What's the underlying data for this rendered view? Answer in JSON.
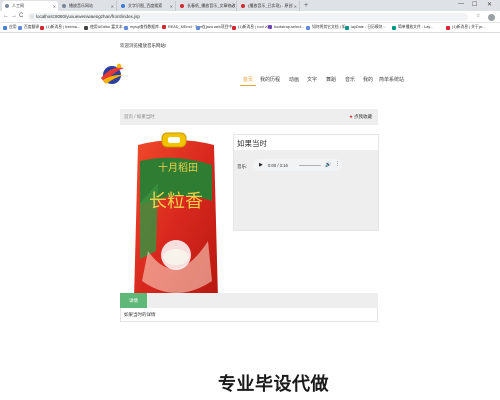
{
  "browser": {
    "tabs": [
      {
        "title": "人工网"
      },
      {
        "title": "播放音乐网站"
      },
      {
        "title": "文字识图_百度搜索"
      },
      {
        "title": "长春纸_播放音乐_文章修改"
      },
      {
        "title": "(播放音乐_已实现) - 原创"
      }
    ],
    "new_tab": "+",
    "window_controls": {
      "minimize": "—",
      "maximize": "☐",
      "close": "✕"
    },
    "nav": {
      "back": "←",
      "forward": "→",
      "reload": "C"
    },
    "url": "localhost:8080/yuxueweniwaengzhan/front/index.jsp",
    "bookmarks": [
      {
        "label": "应用"
      },
      {
        "label": "百度翻译"
      },
      {
        "label": "(1)新消息 | freema..."
      },
      {
        "label": "使用UEditor 富文本..."
      },
      {
        "label": "mysql查找数据库..."
      },
      {
        "label": "READ_MEmd · Tem..."
      },
      {
        "label": "在java web项目中..."
      },
      {
        "label": "(1)新消息 | root v0..."
      },
      {
        "label": "bootstrap-select..."
      },
      {
        "label": "如何将其它文档 | 如..."
      },
      {
        "label": "layDate - 日历模块..."
      },
      {
        "label": "简单播放文件 - Lay..."
      },
      {
        "label": "(1)新消息 | 关于ja..."
      }
    ]
  },
  "site": {
    "welcome": "欢迎浏览播放音乐网站!",
    "nav": [
      {
        "label": "首页",
        "active": true
      },
      {
        "label": "我的历程",
        "active": false
      },
      {
        "label": "动画",
        "active": false
      },
      {
        "label": "文字",
        "active": false
      },
      {
        "label": "舞蹈",
        "active": false
      },
      {
        "label": "音乐",
        "active": false
      },
      {
        "label": "我的",
        "active": false
      },
      {
        "label": "简单系统站",
        "active": false
      }
    ],
    "accent": "#e0a43a"
  },
  "breadcrumb": {
    "home": "首页",
    "separator": "/",
    "current": "如果当时",
    "favorite_icon": "star-icon",
    "favorite_label": "点我收藏"
  },
  "product": {
    "title": "如果当时",
    "audio_label": "音乐:",
    "audio_time": "0:00 / 3:16",
    "play_icon": "play-icon",
    "volume_icon": "volume-icon",
    "more_icon": "more-vertical-icon",
    "package_text": "长粒香",
    "package_banner": "十月稻田"
  },
  "detail": {
    "tab_label": "详情",
    "content": "如果当时的详情",
    "tab_color": "#5fb878"
  },
  "watermark": "专业毕设代做"
}
